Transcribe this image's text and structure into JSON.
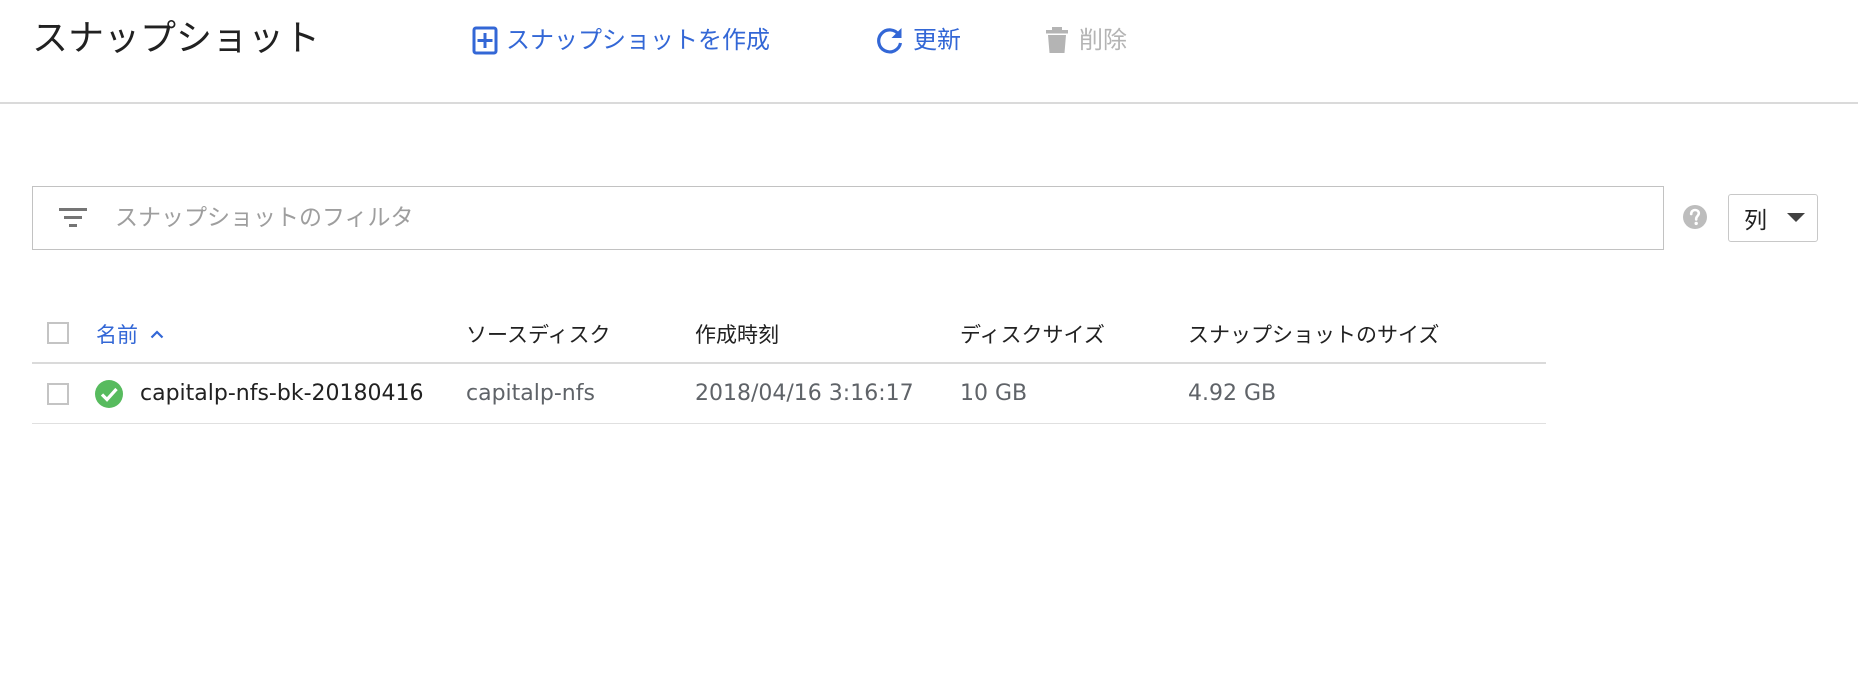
{
  "header": {
    "title": "スナップショット",
    "actions": {
      "create": {
        "label": "スナップショットを作成",
        "icon": "add-box-icon"
      },
      "refresh": {
        "label": "更新",
        "icon": "refresh-icon"
      },
      "delete": {
        "label": "削除",
        "icon": "trash-icon",
        "disabled": true
      }
    }
  },
  "filter": {
    "placeholder": "スナップショットのフィルタ",
    "value": "",
    "icon": "filter-icon"
  },
  "columns_button": {
    "label": "列",
    "icon": "caret-down-icon"
  },
  "help_icon": "help-icon",
  "table": {
    "columns": {
      "name": "名前",
      "source_disk": "ソースディスク",
      "created": "作成時刻",
      "disk_size": "ディスクサイズ",
      "snapshot_size": "スナップショットのサイズ"
    },
    "sort": {
      "column": "name",
      "direction": "ascending"
    },
    "rows": [
      {
        "status": "ok",
        "name": "capitalp-nfs-bk-20180416",
        "source_disk": "capitalp-nfs",
        "created": "2018/04/16 3:16:17",
        "disk_size": "10 GB",
        "snapshot_size": "4.92 GB"
      }
    ]
  },
  "colors": {
    "accent": "#3367d6",
    "disabled": "#b4b4b4",
    "success": "#57bb5e",
    "text": "#212121",
    "secondary_text": "#5f6368"
  }
}
